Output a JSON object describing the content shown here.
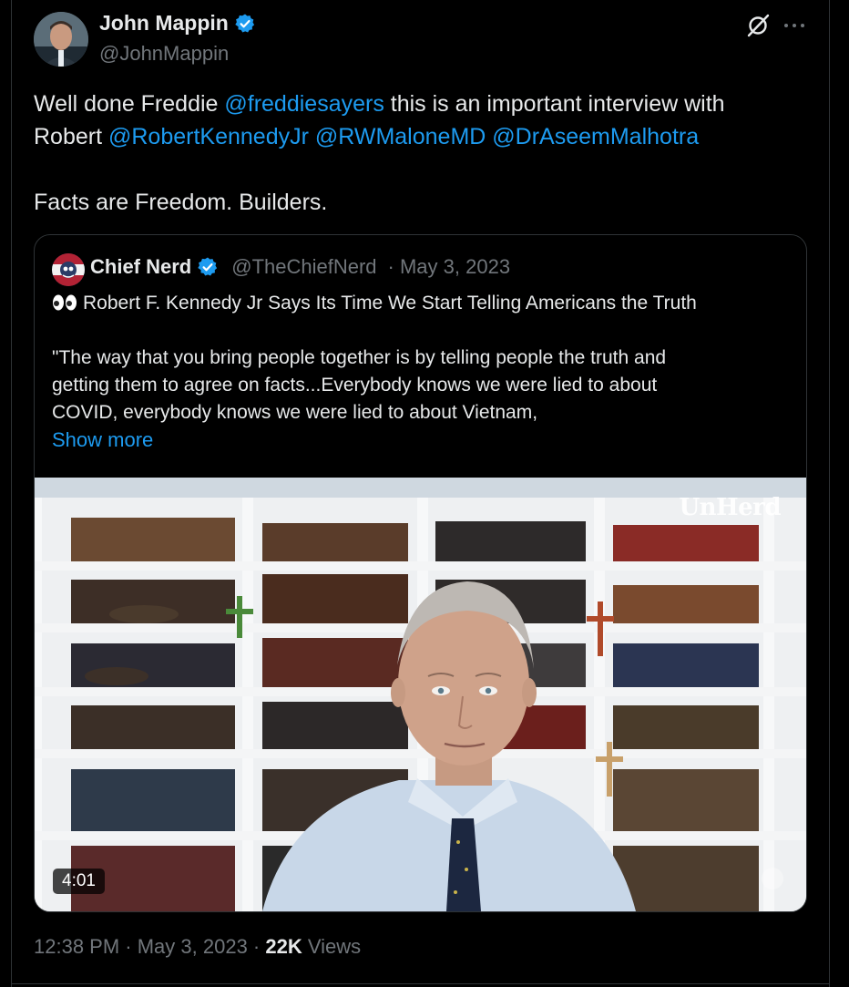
{
  "author": {
    "name": "John Mappin",
    "handle": "@JohnMappin",
    "verified": true,
    "avatar_icon": "avatar-photo"
  },
  "header_icons": [
    "grok-icon",
    "more-icon"
  ],
  "tweet": {
    "line1_prefix": "Well done Freddie ",
    "line1_mention": "@freddiesayers",
    "line1_suffix": " this is an important interview with",
    "line2_prefix": "Robert ",
    "line2_mentions": [
      "@RobertKennedyJr",
      "@RWMaloneMD",
      "@DrAseemMalhotra"
    ],
    "line3": "Facts are Freedom. Builders."
  },
  "quoted_tweet": {
    "name": "Chief Nerd",
    "handle": "@TheChiefNerd",
    "date": "· May 3, 2023",
    "verified": true,
    "headline": "Robert F. Kennedy Jr Says Its Time We Start Telling Americans the Truth",
    "body_lines": [
      "\"The way that you bring people together is by telling people the truth and",
      "getting them to agree on facts...Everybody knows we were lied to about",
      "COVID, everybody knows we were lied to about Vietnam,"
    ],
    "show_more": "Show more",
    "video": {
      "duration": "4:01",
      "watermark": "UnHerd"
    }
  },
  "meta": {
    "time": "12:38 PM",
    "date": "May 3, 2023",
    "views_count": "22K",
    "views_label": "Views",
    "separator": " · "
  },
  "colors": {
    "background": "#000000",
    "text": "#e7e9ea",
    "muted": "#71767b",
    "link": "#1d9bf0",
    "border": "#2f3336",
    "verified": "#1d9bf0"
  }
}
